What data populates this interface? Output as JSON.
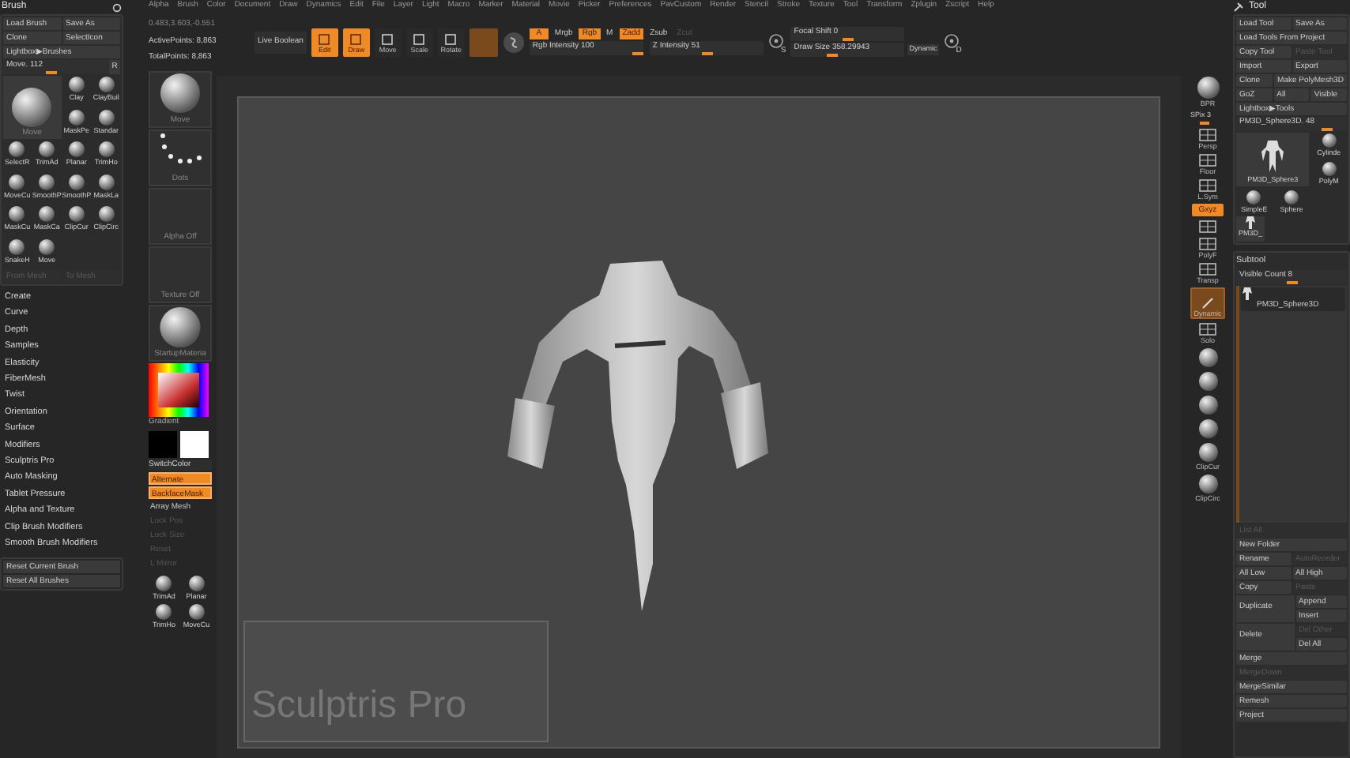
{
  "menu_bar": [
    "Alpha",
    "Brush",
    "Color",
    "Document",
    "Draw",
    "Dynamics",
    "Edit",
    "File",
    "Layer",
    "Light",
    "Macro",
    "Marker",
    "Material",
    "Movie",
    "Picker",
    "Preferences",
    "PavCustom",
    "Render",
    "Stencil",
    "Stroke",
    "Texture",
    "Tool",
    "Transform",
    "Zplugin",
    "Zscript",
    "Help"
  ],
  "brush_panel": {
    "title": "Brush",
    "buttons": [
      {
        "label": "Load Brush",
        "disabled": false
      },
      {
        "label": "Save As",
        "disabled": false
      },
      {
        "label": "Clone",
        "disabled": false
      },
      {
        "label": "SelectIcon",
        "disabled": false
      }
    ],
    "lightbox": "Lightbox▶Brushes",
    "slider": {
      "label": "Move. 112",
      "level": 0.45
    },
    "slider_button": "R",
    "current_brush": "Move",
    "brushes": [
      "Clay",
      "ClayBuil",
      "MaskPe",
      "Standar",
      "SelectR",
      "TrimAd",
      "Planar",
      "TrimHo",
      "MoveCu",
      "SmoothP",
      "SmoothP",
      "MaskLa",
      "MaskCu",
      "MaskCa",
      "ClipCur",
      "ClipCirc",
      "SnakeH",
      "Move"
    ],
    "mesh_buttons": [
      {
        "label": "From Mesh",
        "disabled": true
      },
      {
        "label": "To Mesh",
        "disabled": true
      }
    ],
    "sections": [
      "Create",
      "Curve",
      "Depth",
      "Samples",
      "Elasticity",
      "FiberMesh",
      "Twist",
      "Orientation",
      "Surface",
      "Modifiers",
      "Sculptris Pro",
      "Auto Masking",
      "Tablet Pressure",
      "Alpha and Texture",
      "Clip Brush Modifiers",
      "Smooth Brush Modifiers"
    ],
    "reset_buttons": [
      "Reset Current Brush",
      "Reset All Brushes"
    ]
  },
  "stats": [
    "0.483,3.603,-0.551",
    "ActivePoints: 8,863",
    "TotalPoints: 8,863"
  ],
  "toolbar": {
    "live_boolean": "Live Boolean",
    "modes": [
      {
        "label": "Edit",
        "selected": true
      },
      {
        "label": "Draw",
        "selected": true
      },
      {
        "label": "Move",
        "selected": false
      },
      {
        "label": "Scale",
        "selected": false
      },
      {
        "label": "Rotate",
        "selected": false
      }
    ],
    "channels": [
      {
        "label": "A",
        "on": true,
        "disabled": false
      },
      {
        "label": "Mrgb",
        "on": false,
        "disabled": false
      },
      {
        "label": "Rgb",
        "on": true,
        "disabled": false
      },
      {
        "label": "M",
        "on": false,
        "disabled": false
      },
      {
        "label": "Zadd",
        "on": true,
        "disabled": false
      },
      {
        "label": "Zsub",
        "on": false,
        "disabled": false
      },
      {
        "label": "Zcut",
        "on": false,
        "disabled": true
      }
    ],
    "sliders": [
      {
        "label": "Rgb Intensity 100",
        "level": 1.0
      },
      {
        "label": "Z Intensity 51",
        "level": 0.51
      }
    ],
    "draw_sliders": [
      {
        "label": "Focal Shift 0",
        "level": 0.5
      },
      {
        "label": "Draw Size 358.29943",
        "level": 0.35
      }
    ],
    "dynamic": "Dynamic",
    "s_label": "S",
    "d_label": "D"
  },
  "left_shelf": [
    {
      "kind": "thumb",
      "label": "Move"
    },
    {
      "kind": "dots",
      "label": "Dots"
    },
    {
      "kind": "empty",
      "label": "Alpha Off"
    },
    {
      "kind": "empty",
      "label": "Texture Off"
    },
    {
      "kind": "sphere",
      "label": "StartupMateria"
    },
    {
      "kind": "color",
      "label": "Gradient"
    },
    {
      "kind": "swatches",
      "label": "SwitchColor"
    },
    {
      "kind": "toggle",
      "label": "Alternate",
      "on": true,
      "disabled": false
    },
    {
      "kind": "toggle",
      "label": "BackfaceMask",
      "on": true,
      "disabled": false
    },
    {
      "kind": "toggle",
      "label": "Array Mesh",
      "on": false,
      "disabled": false
    },
    {
      "kind": "toggle",
      "label": "Lock Pos",
      "on": false,
      "disabled": true
    },
    {
      "kind": "toggle",
      "label": "Lock Size",
      "on": false,
      "disabled": true
    },
    {
      "kind": "toggle",
      "label": "Reset",
      "on": false,
      "disabled": true
    },
    {
      "kind": "toggle",
      "label": "L Mirror",
      "on": false,
      "disabled": true
    },
    {
      "kind": "brushes",
      "items": [
        "TrimAd",
        "Planar",
        "TrimHo",
        "MoveCu"
      ]
    }
  ],
  "canvas": {
    "note": "Sculptris Pro"
  },
  "right_shelf": [
    {
      "kind": "sphere",
      "label": "BPR",
      "on": false
    },
    {
      "kind": "slider",
      "label": "SPix 3",
      "level": 0.4
    },
    {
      "kind": "grid",
      "label": "Persp",
      "on": false
    },
    {
      "kind": "floor",
      "label": "Floor",
      "on": false
    },
    {
      "kind": "sym",
      "label": "L.Sym",
      "on": false
    },
    {
      "kind": "button",
      "label": "Gxyz",
      "on": true
    },
    {
      "kind": "small",
      "on": false
    },
    {
      "kind": "grid",
      "label": "PolyF",
      "on": false
    },
    {
      "kind": "transp",
      "label": "Transp",
      "on": false
    },
    {
      "kind": "big",
      "label": "Dynamic",
      "on": true
    },
    {
      "kind": "solo",
      "label": "Solo",
      "on": false
    },
    {
      "kind": "mat",
      "on": false
    },
    {
      "kind": "mat",
      "on": false
    },
    {
      "kind": "mat",
      "on": false
    },
    {
      "kind": "mat",
      "on": false
    },
    {
      "kind": "mat",
      "label": "ClipCur",
      "on": false
    },
    {
      "kind": "mat",
      "label": "ClipCirc",
      "on": false
    }
  ],
  "tool_panel": {
    "title": "Tool",
    "button_rows": [
      [
        {
          "label": "Load Tool",
          "disabled": false
        },
        {
          "label": "Save As",
          "disabled": false
        }
      ],
      [
        {
          "label": "Load Tools From Project",
          "disabled": false
        }
      ],
      [
        {
          "label": "Copy Tool",
          "disabled": false
        },
        {
          "label": "Paste Tool",
          "disabled": true
        }
      ],
      [
        {
          "label": "Import",
          "disabled": false
        },
        {
          "label": "Export",
          "disabled": false
        }
      ],
      [
        {
          "label": "Clone",
          "disabled": false
        },
        {
          "label": "Make PolyMesh3D",
          "disabled": false
        }
      ],
      [
        {
          "label": "GoZ",
          "disabled": false
        },
        {
          "label": "All",
          "disabled": false
        },
        {
          "label": "Visible",
          "disabled": false
        }
      ],
      [
        {
          "label": "Lightbox▶Tools",
          "disabled": false
        }
      ]
    ],
    "slider": {
      "label": "PM3D_Sphere3D. 48",
      "level": 0.85
    },
    "current_tool": "PM3D_Sphere3",
    "tools": [
      "Cylinde",
      "PolyM",
      "SimpleE",
      "Sphere"
    ],
    "recent_tool": "PM3D_",
    "subtool": {
      "title": "Subtool",
      "visible_slider": {
        "label": "Visible Count 8",
        "level": 0.5
      },
      "item": "PM3D_Sphere3D"
    },
    "list_rows": [
      [
        {
          "label": "List All",
          "disabled": true
        }
      ],
      [
        {
          "label": "New Folder",
          "disabled": false
        }
      ]
    ],
    "action_rows": [
      [
        {
          "label": "Rename",
          "disabled": false
        },
        {
          "label": "AutoReorder",
          "disabled": true
        }
      ],
      [
        {
          "label": "All Low",
          "disabled": false
        },
        {
          "label": "All High",
          "disabled": false
        }
      ],
      [
        {
          "label": "Copy",
          "disabled": false
        },
        {
          "label": "Paste",
          "disabled": true
        }
      ]
    ],
    "duplicate": {
      "label": "Duplicate",
      "options": [
        {
          "label": "Append",
          "disabled": false
        },
        {
          "label": "Insert",
          "disabled": false
        }
      ]
    },
    "delete": {
      "label": "Delete",
      "options": [
        {
          "label": "Del Other",
          "disabled": true
        },
        {
          "label": "Del All",
          "disabled": false
        }
      ]
    },
    "more": [
      {
        "label": "Merge",
        "disabled": false
      },
      {
        "label": "MergeDown",
        "disabled": true
      },
      {
        "label": "MergeSimilar",
        "disabled": false
      },
      {
        "label": "Remesh",
        "disabled": false
      },
      {
        "label": "Project",
        "disabled": false
      }
    ]
  }
}
